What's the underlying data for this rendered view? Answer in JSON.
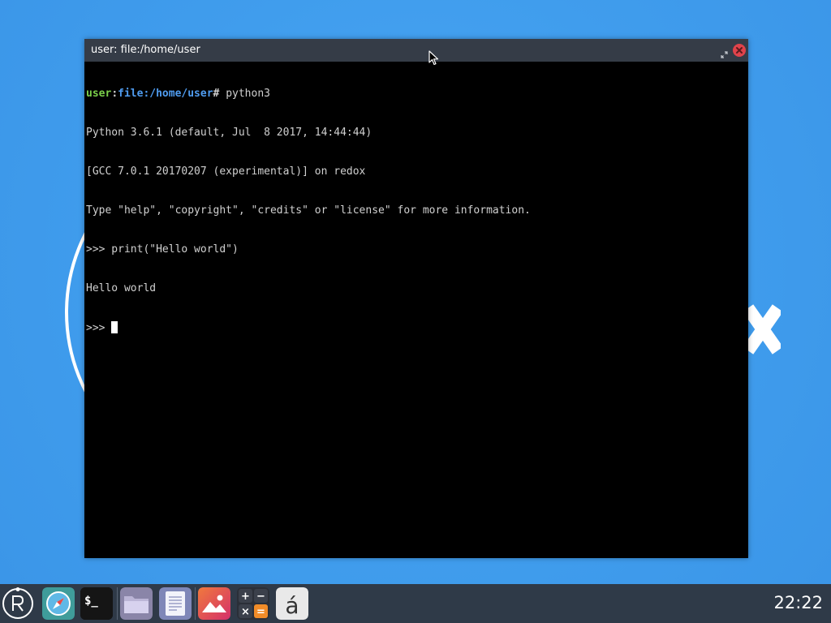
{
  "window": {
    "title": "user: file:/home/user"
  },
  "terminal": {
    "prompt_user": "user",
    "prompt_colon": ":",
    "prompt_path": "file:/home/user",
    "prompt_hash": "#",
    "command": " python3",
    "lines": [
      "Python 3.6.1 (default, Jul  8 2017, 14:44:44)",
      "[GCC 7.0.1 20170207 (experimental)] on redox",
      "Type \"help\", \"copyright\", \"credits\" or \"license\" for more information.",
      ">>> print(\"Hello world\")",
      "Hello world"
    ],
    "current_prompt": ">>> "
  },
  "taskbar": {
    "items": [
      {
        "name": "redox-launcher",
        "icon": "redox-logo-icon"
      },
      {
        "name": "browser",
        "icon": "compass-icon"
      },
      {
        "name": "terminal",
        "icon": "terminal-icon",
        "glyph": "$_"
      },
      {
        "name": "file-manager",
        "icon": "folder-icon"
      },
      {
        "name": "editor",
        "icon": "document-icon"
      },
      {
        "name": "image-viewer",
        "icon": "image-icon"
      },
      {
        "name": "calculator",
        "icon": "calculator-icon",
        "glyph_plus": "+",
        "glyph_minus": "−",
        "glyph_times": "×",
        "glyph_equals": "="
      },
      {
        "name": "character-map",
        "icon": "character-map-icon",
        "glyph": "á"
      }
    ],
    "clock": "22:22"
  },
  "colors": {
    "desktop_bg": "#43a0ee",
    "taskbar_bg": "#2f3a48",
    "titlebar_bg": "#353c47",
    "close_button": "#e0434b",
    "prompt_user": "#7bd04a",
    "prompt_path": "#4f9cf0"
  }
}
